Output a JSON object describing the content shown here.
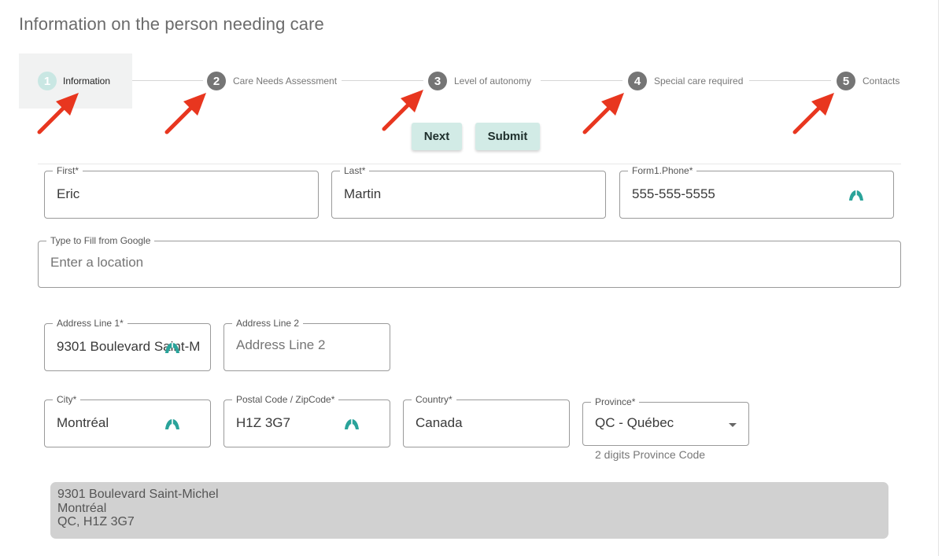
{
  "page": {
    "title": "Information on the person needing care"
  },
  "stepper": {
    "steps": [
      {
        "number": "1",
        "label": "Information"
      },
      {
        "number": "2",
        "label": "Care Needs Assessment"
      },
      {
        "number": "3",
        "label": "Level of autonomy"
      },
      {
        "number": "4",
        "label": "Special care required"
      },
      {
        "number": "5",
        "label": "Contacts"
      }
    ]
  },
  "actions": {
    "next_label": "Next",
    "submit_label": "Submit"
  },
  "form": {
    "first": {
      "label": "First",
      "required_mark": "*",
      "value": "Eric"
    },
    "last": {
      "label": "Last",
      "required_mark": "*",
      "value": "Martin"
    },
    "phone": {
      "label": "Form1.Phone",
      "required_mark": "*",
      "value": "555-555-5555"
    },
    "google": {
      "label": "Type to Fill from Google",
      "placeholder": "Enter a location"
    },
    "address1": {
      "label": "Address Line 1",
      "required_mark": "*",
      "value": "9301 Boulevard Saint-M"
    },
    "address2": {
      "label": "Address Line 2",
      "placeholder": "Address Line 2"
    },
    "city": {
      "label": "City",
      "required_mark": "*",
      "value": "Montréal"
    },
    "postal": {
      "label": "Postal Code / ZipCode",
      "required_mark": "*",
      "value": "H1Z 3G7"
    },
    "country": {
      "label": "Country",
      "required_mark": "*",
      "value": "Canada"
    },
    "province": {
      "label": "Province",
      "required_mark": "*",
      "value": "QC - Québec",
      "helper": "2 digits Province Code"
    }
  },
  "address_summary": {
    "line1": "9301 Boulevard Saint-Michel",
    "line2": "Montréal",
    "line3": "QC, H1Z 3G7"
  },
  "colors": {
    "accent": "#d2ebe6",
    "arrow": "#e8361f",
    "autofill_icon": "#2aa39a",
    "active_step": "#c9e7e3",
    "inactive_step": "#757575"
  },
  "icons": {
    "autofill": "autofill-icon",
    "annotation": "red-arrow-annotation",
    "select": "chevron-down-icon"
  }
}
